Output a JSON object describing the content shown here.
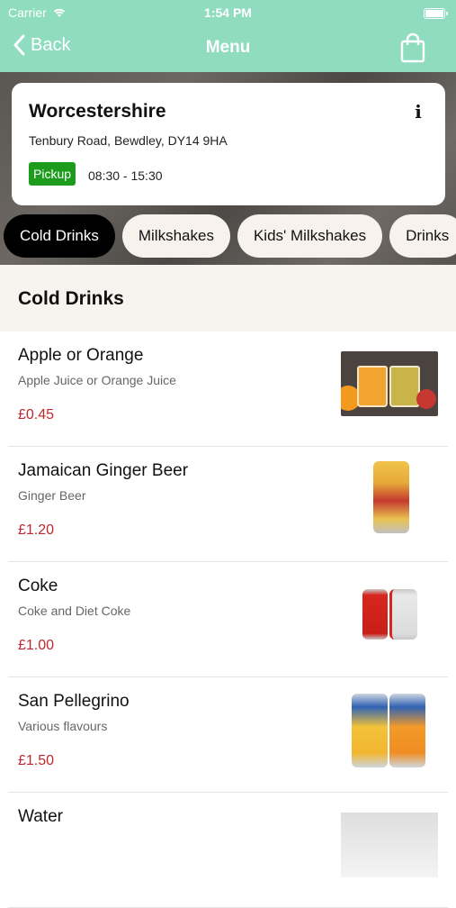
{
  "status_bar": {
    "carrier": "Carrier",
    "time": "1:54 PM"
  },
  "nav": {
    "back_label": "Back",
    "title": "Menu"
  },
  "store": {
    "name": "Worcestershire",
    "address": "Tenbury Road, Bewdley, DY14 9HA",
    "pickup_label": "Pickup",
    "hours": "08:30 - 15:30"
  },
  "category_tabs": [
    {
      "label": "Cold Drinks",
      "active": true
    },
    {
      "label": "Milkshakes",
      "active": false
    },
    {
      "label": "Kids' Milkshakes",
      "active": false
    },
    {
      "label": "Drinks",
      "active": false
    }
  ],
  "section": {
    "title": "Cold Drinks"
  },
  "items": [
    {
      "name": "Apple or Orange",
      "description": "Apple Juice or Orange Juice",
      "price": "£0.45",
      "image": "juice-glasses"
    },
    {
      "name": "Jamaican Ginger Beer",
      "description": "Ginger Beer",
      "price": "£1.20",
      "image": "ginger-beer-can"
    },
    {
      "name": "Coke",
      "description": "Coke and Diet Coke",
      "price": "£1.00",
      "image": "coke-cans"
    },
    {
      "name": "San Pellegrino",
      "description": "Various flavours",
      "price": "£1.50",
      "image": "san-pellegrino-cans"
    },
    {
      "name": "Water",
      "description": "",
      "price": "",
      "image": "water-bottle"
    }
  ],
  "colors": {
    "nav_bar": "#8fdcc0",
    "pickup_badge": "#1c9b1c",
    "price": "#c0282d",
    "active_tab": "#000000",
    "inactive_tab": "#f7f2ec"
  }
}
